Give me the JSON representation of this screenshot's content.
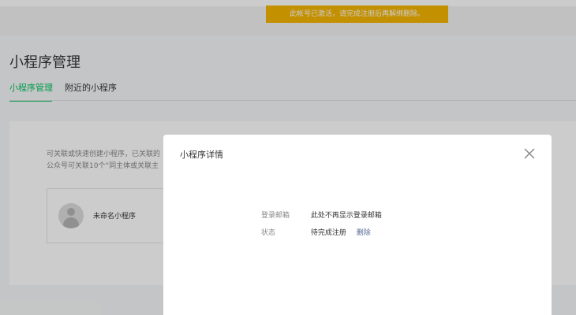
{
  "notice": {
    "text": "此帐号已激活，请完成注册后再解绑删除。"
  },
  "page": {
    "title": "小程序管理"
  },
  "tabs": [
    {
      "label": "小程序管理",
      "active": true
    },
    {
      "label": "附近的小程序",
      "active": false
    }
  ],
  "card": {
    "description_line1": "可关联或快速创建小程序，已关联的",
    "description_line2": "公众号可关联10个“同主体或关联主",
    "app": {
      "name": "未命名小程序",
      "avatar_icon": "default-avatar-icon"
    }
  },
  "dialog": {
    "title": "小程序详情",
    "close_icon": "close-icon",
    "rows": [
      {
        "label": "登录邮箱",
        "value": "此处不再显示登录邮箱"
      },
      {
        "label": "状态",
        "value": "待完成注册",
        "link": "删除"
      }
    ]
  },
  "colors": {
    "accent": "#07c160",
    "notice_bg": "#f4b400",
    "link": "#576b95"
  }
}
